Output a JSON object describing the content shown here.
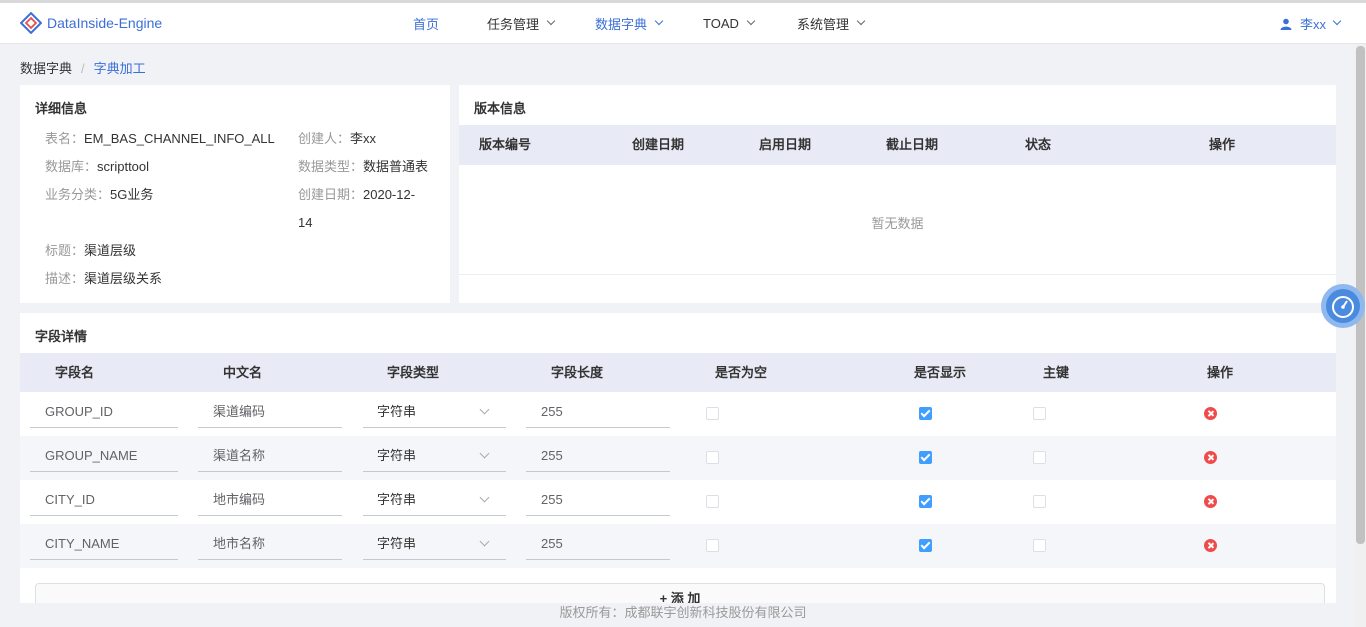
{
  "header": {
    "logo_text": "DataInside-Engine",
    "nav": [
      {
        "label": "首页"
      },
      {
        "label": "任务管理"
      },
      {
        "label": "数据字典"
      },
      {
        "label": "TOAD"
      },
      {
        "label": "系统管理"
      }
    ],
    "active_nav": "数据字典",
    "user_name": "李xx"
  },
  "breadcrumb": {
    "parent": "数据字典",
    "separator": "/",
    "current": "字典加工"
  },
  "detail": {
    "title": "详细信息",
    "table_name": {
      "label": "表名：",
      "value": "EM_BAS_CHANNEL_INFO_ALL"
    },
    "creator": {
      "label": "创建人：",
      "value": "李xx"
    },
    "database": {
      "label": "数据库：",
      "value": "scripttool"
    },
    "data_type": {
      "label": "数据类型：",
      "value": "数据普通表"
    },
    "business_category": {
      "label": "业务分类：",
      "value": "5G业务"
    },
    "created_date": {
      "label": "创建日期：",
      "value_line1": "2020-12-",
      "value_line2": "14"
    },
    "heading": {
      "label": "标题：",
      "value": "渠道层级"
    },
    "description": {
      "label": "描述：",
      "value": "渠道层级关系"
    }
  },
  "version": {
    "title": "版本信息",
    "columns": [
      "版本编号",
      "创建日期",
      "启用日期",
      "截止日期",
      "状态",
      "操作"
    ],
    "empty_text": "暂无数据"
  },
  "fields": {
    "title": "字段详情",
    "columns": [
      "字段名",
      "中文名",
      "字段类型",
      "字段长度",
      "是否为空",
      "是否显示",
      "主键",
      "操作"
    ],
    "rows": [
      {
        "name": "GROUP_ID",
        "cn_name": "渠道编码",
        "type": "字符串",
        "length": "255",
        "nullable": false,
        "visible": true,
        "primary_key": false
      },
      {
        "name": "GROUP_NAME",
        "cn_name": "渠道名称",
        "type": "字符串",
        "length": "255",
        "nullable": false,
        "visible": true,
        "primary_key": false
      },
      {
        "name": "CITY_ID",
        "cn_name": "地市编码",
        "type": "字符串",
        "length": "255",
        "nullable": false,
        "visible": true,
        "primary_key": false
      },
      {
        "name": "CITY_NAME",
        "cn_name": "地市名称",
        "type": "字符串",
        "length": "255",
        "nullable": false,
        "visible": true,
        "primary_key": false
      }
    ],
    "add_label": "+ 添 加"
  },
  "footer": {
    "copyright": "版权所有：成都联宇创新科技股份有限公司"
  },
  "colors": {
    "accent": "#3b6fd8",
    "checkbox_on": "#409eff",
    "delete": "#f04b4b",
    "table_header_bg": "#e8ebf6"
  },
  "icons": {
    "logo": "diamond-logo-icon",
    "user": "user-icon",
    "dropdown": "chevron-down-icon",
    "delete": "delete-circle-icon",
    "float": "speedometer-icon"
  }
}
